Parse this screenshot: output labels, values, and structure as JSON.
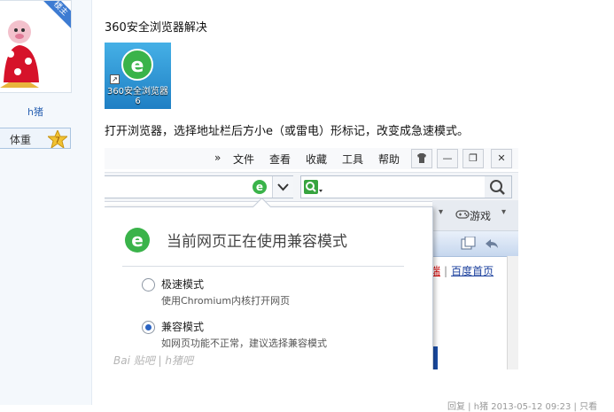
{
  "sidebar": {
    "badge": "楼主",
    "username": "h猪",
    "weight_label": "体重",
    "level": "7"
  },
  "post": {
    "title": "360安全浏览器解决",
    "desktop_icon_label": "360安全浏览器6",
    "body_text": "打开浏览器，选择地址栏后方小e（或雷电）形标记，改变成急速模式。"
  },
  "browser": {
    "menu": {
      "more": "»",
      "items": [
        "文件",
        "查看",
        "收藏",
        "工具",
        "帮助"
      ]
    },
    "window_buttons": [
      "shirt-icon",
      "minimize",
      "restore",
      "close"
    ],
    "popup": {
      "title": "当前网页正在使用兼容模式",
      "options": [
        {
          "title": "极速模式",
          "desc": "使用Chromium内核打开网页",
          "selected": false
        },
        {
          "title": "兼容模式",
          "desc": "如网页功能不正常，建议选择兼容模式",
          "selected": true
        }
      ]
    },
    "tabbar": {
      "game_label": "游戏"
    },
    "links": {
      "red": "端",
      "blue": "百度首页"
    }
  },
  "watermark": "Bai 贴吧 | h猪吧",
  "footer_meta": "回复 | h猪 2013-05-12 09:23 | 只看",
  "colors": {
    "accent_blue": "#2d64b3",
    "ribbon_blue": "#3d7bd2",
    "ie_green": "#3ab34a",
    "link_red": "#cc0000",
    "link_blue": "#1a3f9c"
  }
}
